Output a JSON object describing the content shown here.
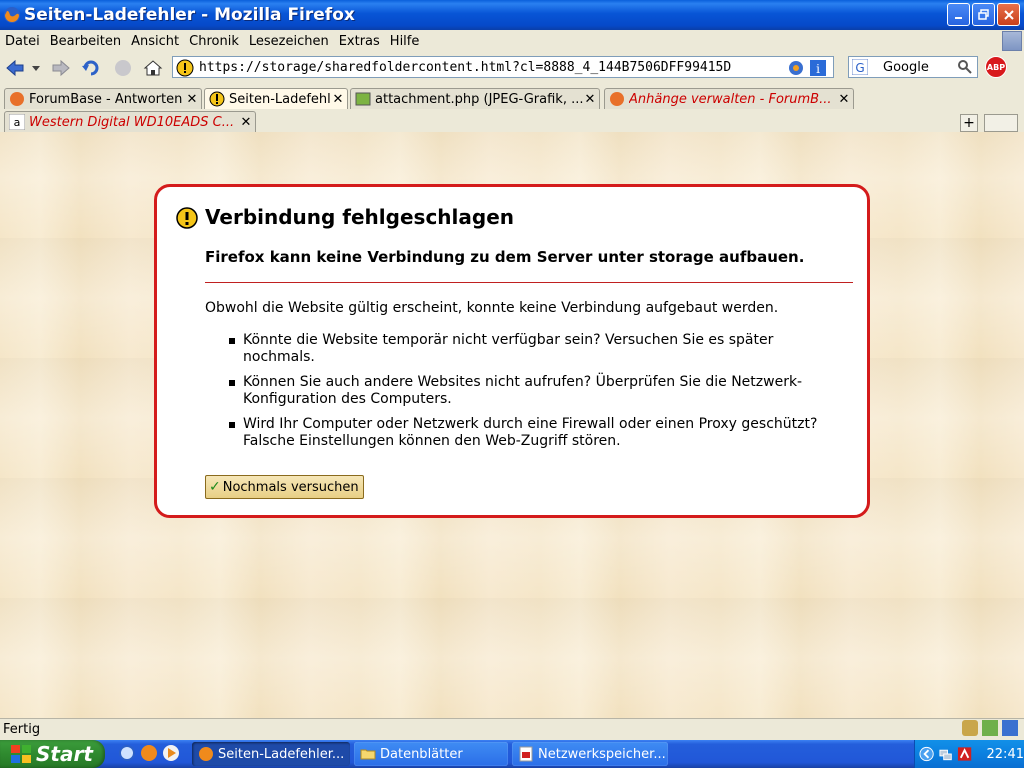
{
  "window": {
    "title": "Seiten-Ladefehler - Mozilla Firefox"
  },
  "menu": {
    "items": [
      {
        "label": "Datei"
      },
      {
        "label": "Bearbeiten"
      },
      {
        "label": "Ansicht"
      },
      {
        "label": "Chronik"
      },
      {
        "label": "Lesezeichen"
      },
      {
        "label": "Extras"
      },
      {
        "label": "Hilfe"
      }
    ]
  },
  "navbar": {
    "url": "https://storage/sharedfoldercontent.html?cl=8888_4_144B7506DFF99415D",
    "search_engine": "Google"
  },
  "tabs": [
    {
      "label": "ForumBase - Antworten",
      "active": false,
      "loading_error": false
    },
    {
      "label": "Seiten-Ladefehler",
      "active": true,
      "loading_error": false
    },
    {
      "label": "attachment.php (JPEG-Grafik, ...",
      "active": false,
      "loading_error": false
    },
    {
      "label": "Anhänge verwalten - ForumB...",
      "active": false,
      "loading_error": true
    },
    {
      "label": "Western Digital WD10EADS C...",
      "active": false,
      "loading_error": true
    }
  ],
  "error": {
    "title": "Verbindung fehlgeschlagen",
    "subtitle": "Firefox kann keine Verbindung zu dem Server unter storage aufbauen.",
    "description": "Obwohl die Website gültig erscheint, konnte keine Verbindung aufgebaut werden.",
    "bullets": [
      "Könnte die Website temporär nicht verfügbar sein? Versuchen Sie es später nochmals.",
      "Können Sie auch andere Websites nicht aufrufen? Überprüfen Sie die Netzwerk-Konfiguration des Computers.",
      "Wird Ihr Computer oder Netzwerk durch eine Firewall oder einen Proxy geschützt? Falsche Einstellungen können den Web-Zugriff stören."
    ],
    "retry_label": "Nochmals versuchen"
  },
  "status": {
    "text": "Fertig"
  },
  "taskbar": {
    "start_label": "Start",
    "buttons": [
      {
        "label": "Seiten-Ladefehler...",
        "active": true
      },
      {
        "label": "Datenblätter",
        "active": false
      },
      {
        "label": "Netzwerkspeicher...",
        "active": false
      }
    ],
    "clock": "22:41"
  },
  "colors": {
    "error_border": "#d41b1b",
    "titlebar_blue": "#0855d6",
    "taskbar_blue": "#245edb",
    "start_green": "#2f8a2f"
  }
}
